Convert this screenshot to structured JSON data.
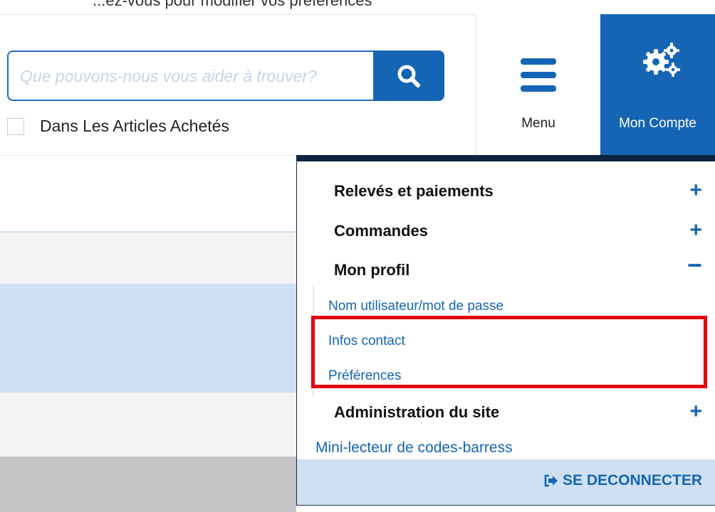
{
  "top_partial_text": "...ez-vous pour modifier vos préférences",
  "search": {
    "placeholder": "Que pouvons-nous vous aider à trouver?",
    "icon": "search-icon"
  },
  "purchased_filter": {
    "label": "Dans Les Articles Achetés",
    "checked": false
  },
  "header": {
    "menu_label": "Menu",
    "account_label": "Mon Compte"
  },
  "account_menu": {
    "sections": [
      {
        "label": "Relevés et paiements",
        "toggle": "+"
      },
      {
        "label": "Commandes",
        "toggle": "+"
      },
      {
        "label": "Mon profil",
        "toggle": "−"
      }
    ],
    "profile_items": [
      "Nom utilisateur/mot de passe",
      "Infos contact",
      "Préférences"
    ],
    "admin": {
      "label": "Administration du site",
      "toggle": "+"
    },
    "barcode_link": "Mini-lecteur de codes-barress",
    "logout": "SE DECONNECTER"
  },
  "colors": {
    "brand_blue": "#1565b4",
    "navy_border": "#0d2340",
    "highlight_red": "#e4000f",
    "light_blue": "#cfe0f5"
  }
}
